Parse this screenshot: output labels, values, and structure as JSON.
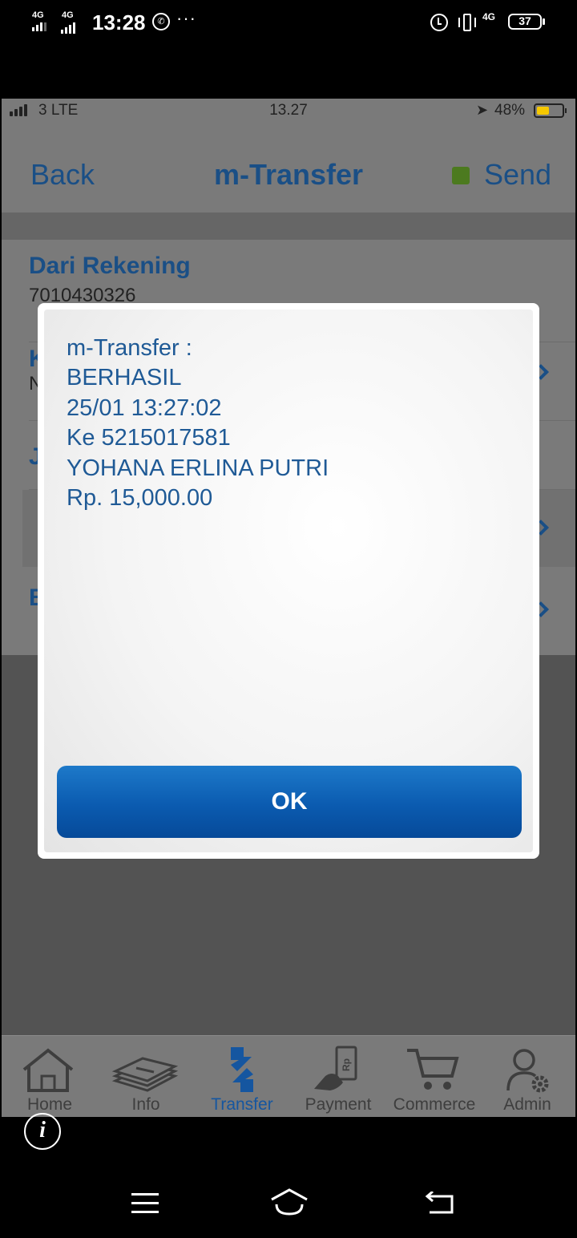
{
  "android_status": {
    "net1": "4G",
    "net2": "4G",
    "time": "13:28",
    "whatsapp_glyph": "✆",
    "more": "···",
    "net_right": "4G",
    "battery": "37"
  },
  "ios_status": {
    "carrier": "3 LTE",
    "time": "13.27",
    "location_glyph": "➤",
    "battery_pct": "48%"
  },
  "nav": {
    "back_label": "Back",
    "title": "m-Transfer",
    "send_label": "Send",
    "send_indicator_color": "#4c7a1f"
  },
  "form": {
    "from_label": "Dari Rekening",
    "from_value": "7010430326",
    "row2_label": "K",
    "row2_value": "N",
    "row3_label": "J",
    "row5_label": "B"
  },
  "dialog": {
    "lines": [
      "m-Transfer :",
      "BERHASIL",
      "25/01 13:27:02",
      "Ke 5215017581",
      "YOHANA ERLINA PUTRI",
      "Rp. 15,000.00"
    ],
    "ok_label": "OK"
  },
  "tabbar": {
    "tabs": [
      {
        "label": "Home",
        "icon": "home-icon"
      },
      {
        "label": "Info",
        "icon": "info-stack-icon"
      },
      {
        "label": "Transfer",
        "icon": "transfer-icon",
        "active": true
      },
      {
        "label": "Payment",
        "icon": "payment-icon"
      },
      {
        "label": "Commerce",
        "icon": "cart-icon"
      },
      {
        "label": "Admin",
        "icon": "admin-icon"
      }
    ]
  },
  "info_button": "i",
  "colors": {
    "accent_blue": "#1a4f86",
    "button_blue": "#0b5bb0",
    "active_tab": "#1556a0"
  }
}
